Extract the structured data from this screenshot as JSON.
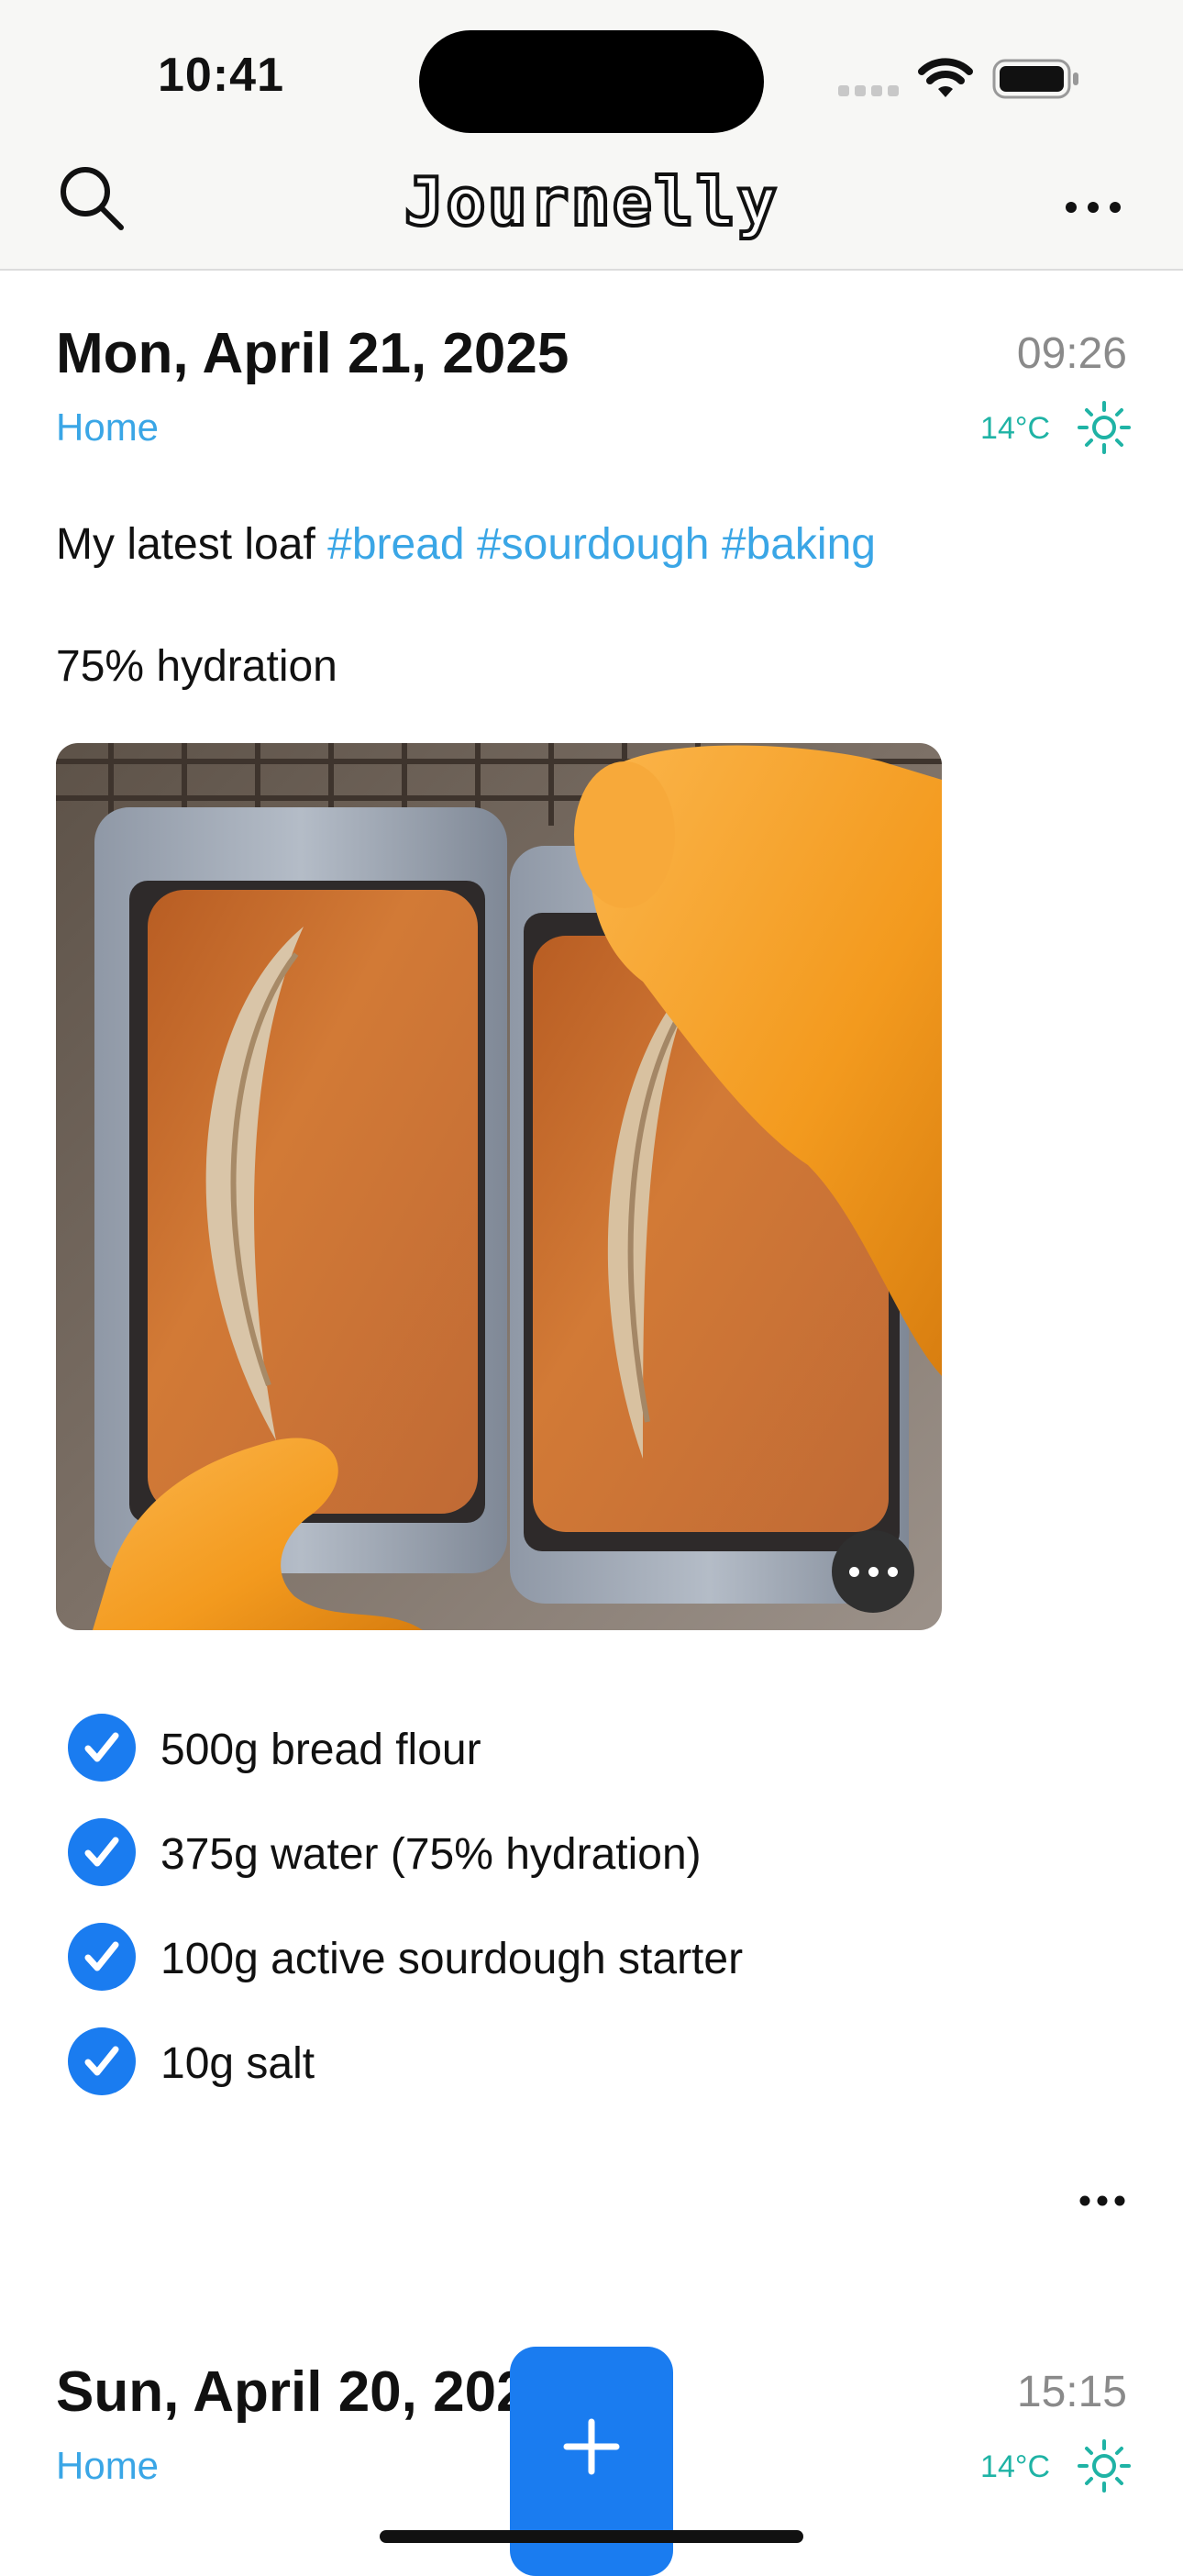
{
  "status_bar": {
    "time": "10:41"
  },
  "nav": {
    "app_title": "Journelly",
    "search_icon": "search-icon",
    "more_icon": "more-horizontal-icon"
  },
  "entries": [
    {
      "date": "Mon, April 21, 2025",
      "time": "09:26",
      "location": "Home",
      "temperature": "14°C",
      "weather_icon": "sun-icon",
      "text_intro": "My latest loaf",
      "hashtags": [
        "#bread",
        "#sourdough",
        "#baking"
      ],
      "note": "75% hydration",
      "photo": {
        "description_icon": "bread-photo",
        "more_icon": "more-horizontal-icon"
      },
      "checklist": [
        {
          "label": "500g bread flour",
          "checked": true
        },
        {
          "label": "375g water (75% hydration)",
          "checked": true
        },
        {
          "label": "100g active sourdough starter",
          "checked": true
        },
        {
          "label": "10g salt",
          "checked": true
        }
      ]
    },
    {
      "date": "Sun, April 20, 2025",
      "time": "15:15",
      "location": "Home",
      "temperature": "14°C",
      "weather_icon": "sun-icon"
    }
  ],
  "fab": {
    "icon": "plus-icon"
  },
  "colors": {
    "accent": "#1a7cf0",
    "link": "#3aa6e6",
    "weather": "#1fb3a5",
    "glove": "#f39a1e"
  }
}
